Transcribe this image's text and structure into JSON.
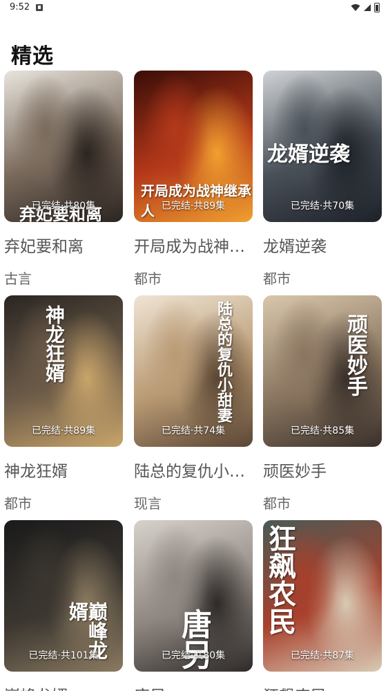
{
  "status_bar": {
    "time": "9:52"
  },
  "section": {
    "title": "精选"
  },
  "cards": [
    {
      "title": "弃妃要和离",
      "genre": "古言",
      "badge": "已完结·共80集",
      "overlay": "弃妃要和离",
      "colors": [
        "#e8e4dd",
        "#7a6a5c",
        "#2b2420"
      ]
    },
    {
      "title": "开局成为战神继承人",
      "genre": "都市",
      "badge": "已完结·共89集",
      "overlay": "开局成为战神继承人",
      "colors": [
        "#3a0d08",
        "#b5391a",
        "#f0a030"
      ]
    },
    {
      "title": "龙婿逆袭",
      "genre": "都市",
      "badge": "已完结·共70集",
      "overlay": "龙婿逆袭",
      "colors": [
        "#cfd3d6",
        "#4a5058",
        "#1d2128"
      ]
    },
    {
      "title": "神龙狂婿",
      "genre": "都市",
      "badge": "已完结·共89集",
      "overlay": "神龙狂婿",
      "colors": [
        "#2a2622",
        "#6b5a48",
        "#c9a56a"
      ]
    },
    {
      "title": "陆总的复仇小甜妻",
      "genre": "现言",
      "badge": "已完结·共74集",
      "overlay": "陆总的复仇小甜妻",
      "colors": [
        "#efe4d4",
        "#b99a74",
        "#5a4634"
      ]
    },
    {
      "title": "顽医妙手",
      "genre": "都市",
      "badge": "已完结·共85集",
      "overlay": "顽医妙手",
      "colors": [
        "#d9c7ac",
        "#8a7660",
        "#3a302a"
      ]
    },
    {
      "title": "巅峰龙婿",
      "genre": "",
      "badge": "已完结·共101集",
      "overlay": "巅峰龙婿",
      "colors": [
        "#1a1a1a",
        "#3b3630",
        "#8a7a60"
      ]
    },
    {
      "title": "唐另",
      "genre": "",
      "badge": "已完结·共80集",
      "overlay": "唐另",
      "colors": [
        "#d8d2cc",
        "#8e8680",
        "#2e2a28"
      ]
    },
    {
      "title": "狂飙农民",
      "genre": "",
      "badge": "已完结·共87集",
      "overlay": "狂飙农民",
      "colors": [
        "#4a5a54",
        "#a8402c",
        "#d8cbb6"
      ]
    }
  ]
}
